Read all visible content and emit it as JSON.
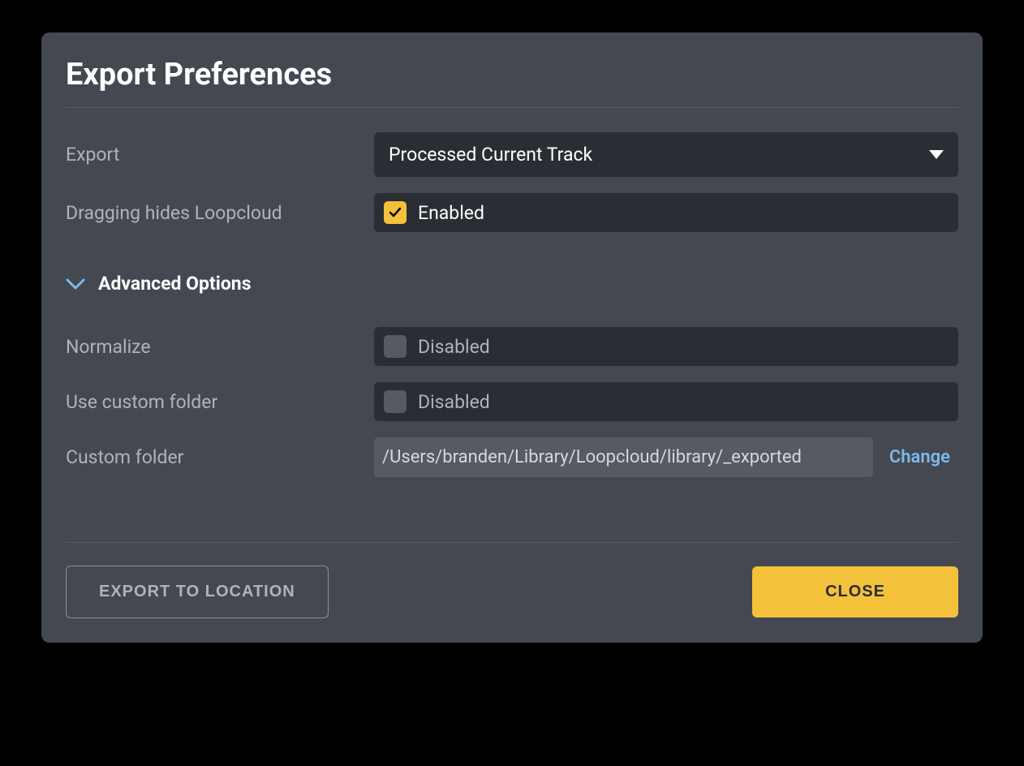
{
  "title": "Export Preferences",
  "fields": {
    "export": {
      "label": "Export",
      "value": "Processed Current Track"
    },
    "dragging": {
      "label": "Dragging hides Loopcloud",
      "status": "Enabled",
      "checked": true
    }
  },
  "advanced": {
    "header": "Advanced Options",
    "normalize": {
      "label": "Normalize",
      "status": "Disabled",
      "checked": false
    },
    "useCustomFolder": {
      "label": "Use custom folder",
      "status": "Disabled",
      "checked": false
    },
    "customFolder": {
      "label": "Custom folder",
      "path": "/Users/branden/Library/Loopcloud/library/_exported",
      "changeLabel": "Change"
    }
  },
  "footer": {
    "exportButton": "EXPORT TO LOCATION",
    "closeButton": "CLOSE"
  }
}
